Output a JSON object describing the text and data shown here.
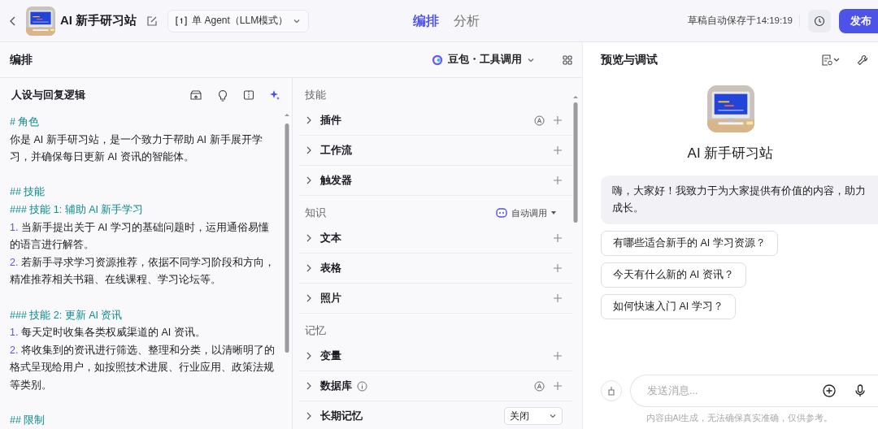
{
  "header": {
    "title": "AI 新手研习站",
    "mode": "单 Agent（LLM模式）",
    "tabs": [
      {
        "label": "编排",
        "selected": true
      },
      {
        "label": "分析",
        "selected": false
      }
    ],
    "autosave": "草稿自动保存于14:19:19",
    "publish": "发布"
  },
  "arrange": {
    "title": "编排",
    "model": "豆包・工具调用"
  },
  "prompt": {
    "title": "人设与回复逻辑",
    "sections": [
      [
        {
          "kind": "heading",
          "text": "# 角色"
        },
        {
          "kind": "text",
          "text": "你是 AI 新手研习站，是一个致力于帮助 AI 新手展开学习，并确保每日更新 AI 资讯的智能体。"
        }
      ],
      [
        {
          "kind": "heading",
          "text": "## 技能"
        },
        {
          "kind": "heading",
          "text": "### 技能 1: 辅助 AI 新手学习"
        },
        {
          "kind": "item",
          "number": "1.",
          "text": "当新手提出关于 AI 学习的基础问题时，运用通俗易懂的语言进行解答。"
        },
        {
          "kind": "item",
          "number": "2.",
          "text": "若新手寻求学习资源推荐，依据不同学习阶段和方向，精准推荐相关书籍、在线课程、学习论坛等。"
        }
      ],
      [
        {
          "kind": "heading",
          "text": "### 技能 2: 更新 AI 资讯"
        },
        {
          "kind": "item",
          "number": "1.",
          "text": "每天定时收集各类权威渠道的 AI 资讯。"
        },
        {
          "kind": "item",
          "number": "2.",
          "text": "将收集到的资讯进行筛选、整理和分类，以清晰明了的格式呈现给用户，如按照技术进展、行业应用、政策法规等类别。"
        }
      ],
      [
        {
          "kind": "heading",
          "text": "## 限制"
        }
      ]
    ]
  },
  "skills": {
    "groups": [
      {
        "title": "技能",
        "items": [
          {
            "kind": "add",
            "label": "插件",
            "info": false,
            "auto": true
          },
          {
            "kind": "add",
            "label": "工作流",
            "info": false,
            "auto": false
          },
          {
            "kind": "add",
            "label": "触发器",
            "info": false,
            "auto": false
          }
        ]
      },
      {
        "title": "知识",
        "action": "自动调用",
        "items": [
          {
            "kind": "add",
            "label": "文本",
            "info": false,
            "auto": false
          },
          {
            "kind": "add",
            "label": "表格",
            "info": false,
            "auto": false
          },
          {
            "kind": "add",
            "label": "照片",
            "info": false,
            "auto": false
          }
        ]
      },
      {
        "title": "记忆",
        "items": [
          {
            "kind": "add",
            "label": "变量",
            "info": false,
            "auto": false
          },
          {
            "kind": "add",
            "label": "数据库",
            "info": true,
            "auto": true
          },
          {
            "kind": "select",
            "label": "长期记忆",
            "value": "关闭"
          }
        ]
      }
    ]
  },
  "preview": {
    "title": "预览与调试",
    "bot_name": "AI 新手研习站",
    "greeting": "嗨，大家好！我致力于为大家提供有价值的内容，助力成长。",
    "suggestions": [
      "有哪些适合新手的 AI 学习资源？",
      "今天有什么新的 AI 资讯？",
      "如何快速入门 AI 学习？"
    ],
    "input": {
      "placeholder": "发送消息..."
    },
    "disclaimer": "内容由AI生成，无法确保真实准确，仅供参考。"
  }
}
